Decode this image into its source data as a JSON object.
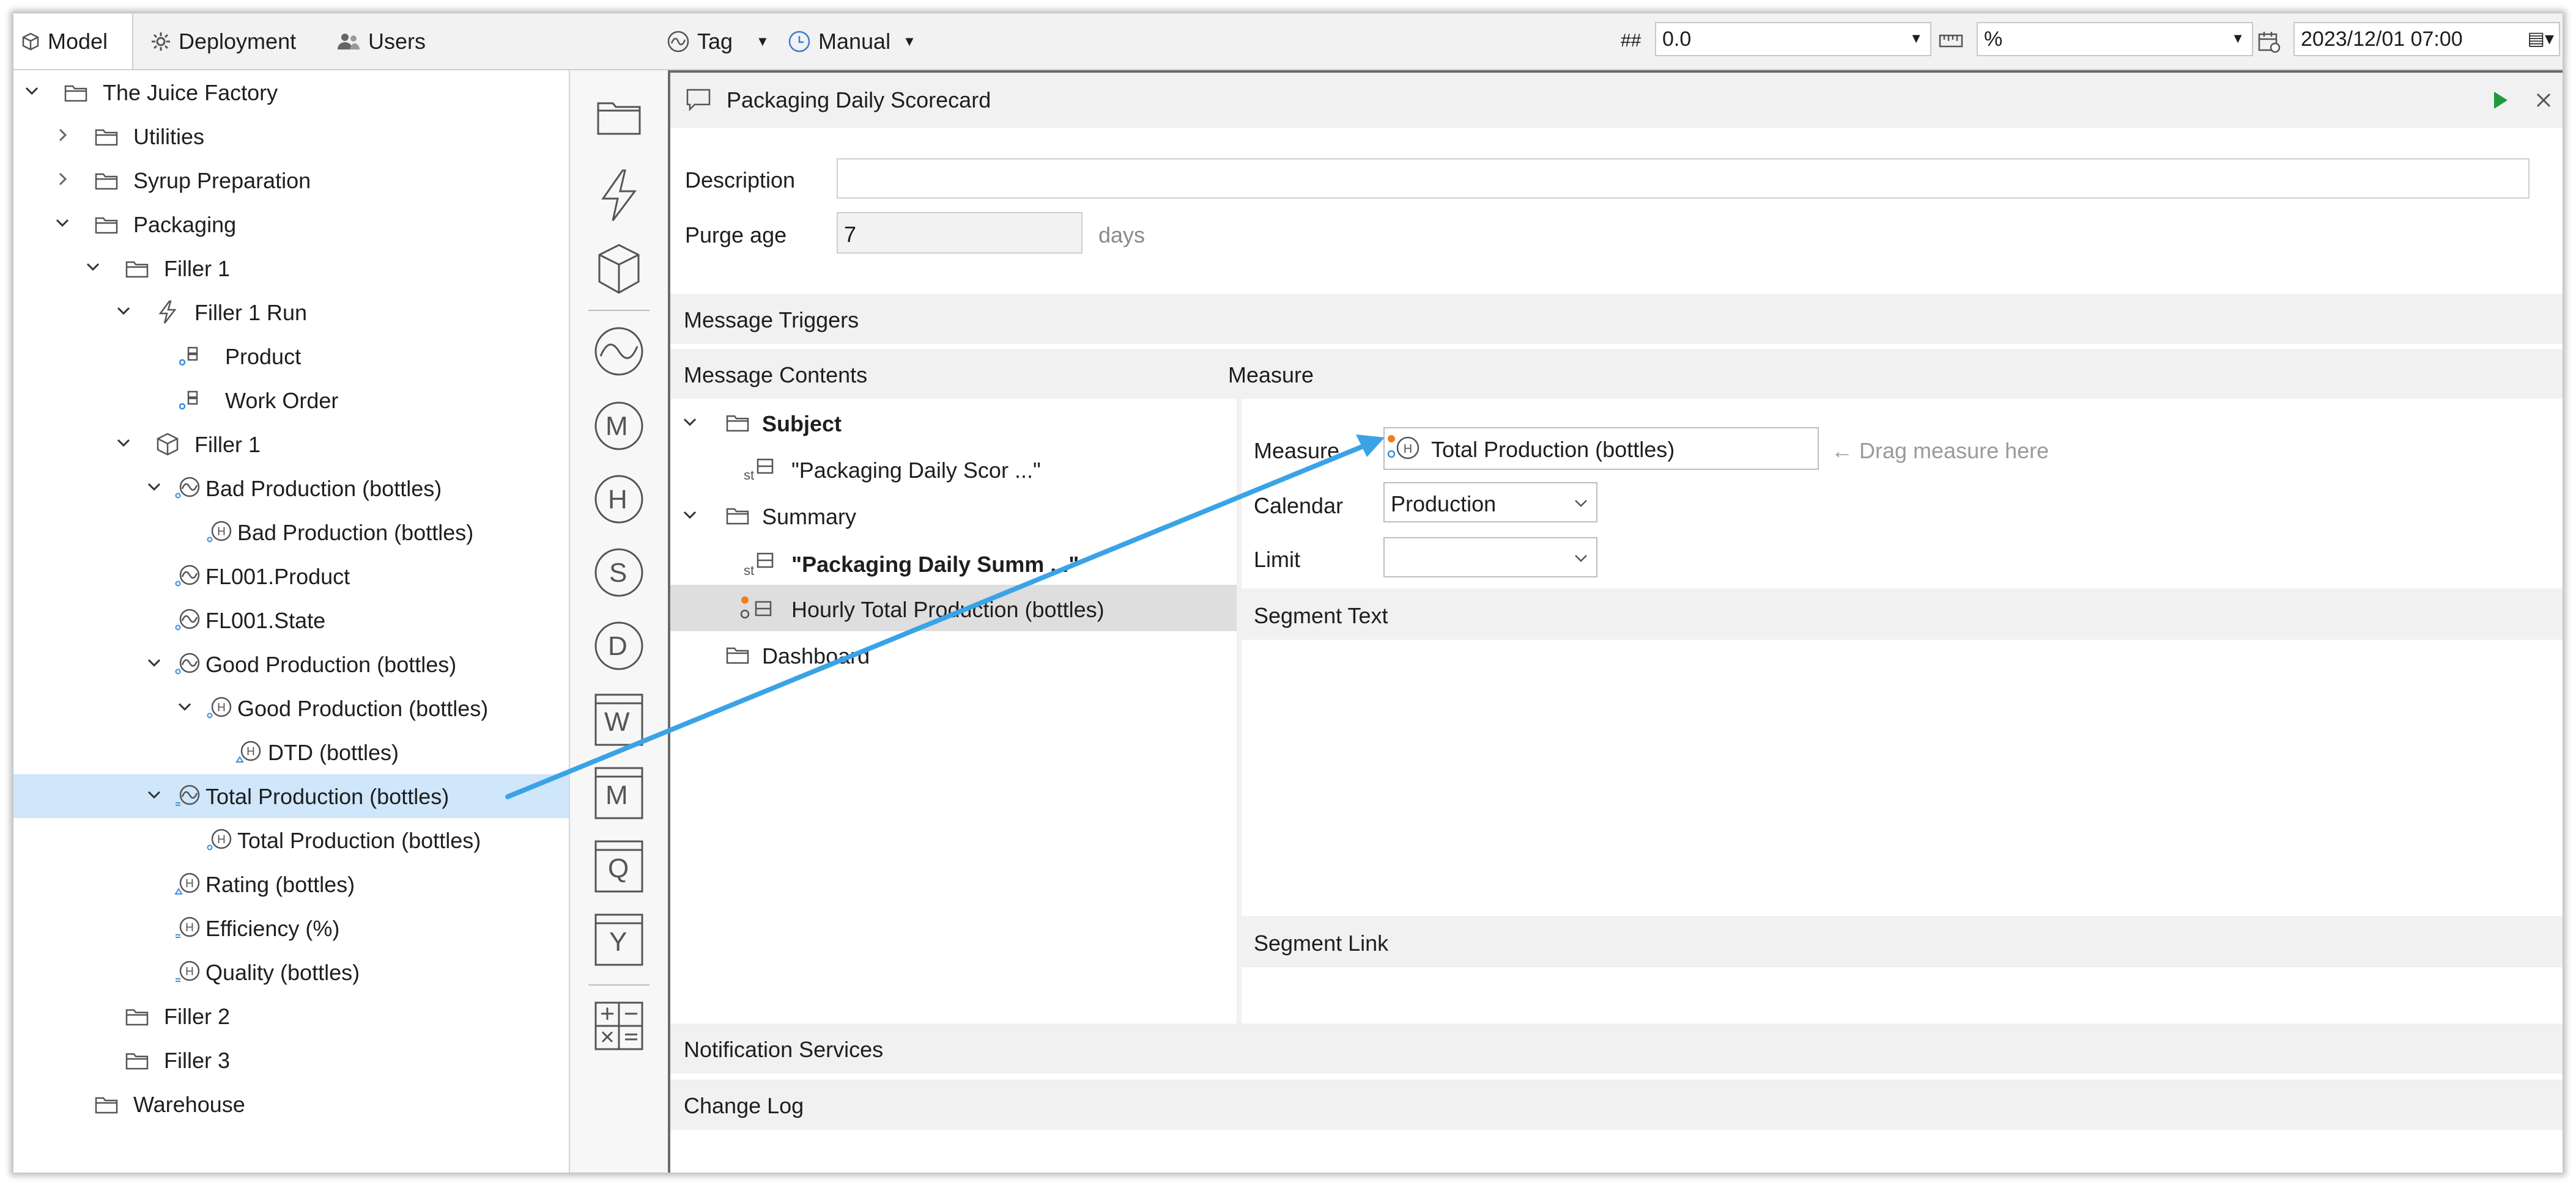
{
  "toolbar": {
    "tabs": [
      {
        "label": "Model",
        "icon": "cube-icon"
      },
      {
        "label": "Deployment",
        "icon": "gear-icon"
      },
      {
        "label": "Users",
        "icon": "users-icon"
      }
    ],
    "tag_label": "Tag",
    "mode_label": "Manual",
    "value_prefix": "##",
    "value": "0.0",
    "unit_value": "%",
    "datetime": "2023/12/01 07:00"
  },
  "tree": {
    "items": [
      {
        "label": "The Juice Factory",
        "icon": "folder-icon"
      },
      {
        "label": "Utilities",
        "icon": "folder-icon"
      },
      {
        "label": "Syrup Preparation",
        "icon": "folder-icon"
      },
      {
        "label": "Packaging",
        "icon": "folder-icon"
      },
      {
        "label": "Filler 1",
        "icon": "folder-icon"
      },
      {
        "label": "Filler 1 Run",
        "icon": "lightning-icon"
      },
      {
        "label": "Product",
        "icon": "attribute-icon"
      },
      {
        "label": "Work Order",
        "icon": "attribute-icon"
      },
      {
        "label": "Filler 1",
        "icon": "cube-icon"
      },
      {
        "label": "Bad Production (bottles)",
        "icon": "tag-icon"
      },
      {
        "label": "Bad Production (bottles)",
        "icon": "calculation-icon"
      },
      {
        "label": "FL001.Product",
        "icon": "tag-icon"
      },
      {
        "label": "FL001.State",
        "icon": "tag-icon"
      },
      {
        "label": "Good Production (bottles)",
        "icon": "tag-icon"
      },
      {
        "label": "Good Production (bottles)",
        "icon": "calculation-icon"
      },
      {
        "label": "DTD (bottles)",
        "icon": "calculation-icon"
      },
      {
        "label": "Total Production (bottles)",
        "icon": "tag-icon"
      },
      {
        "label": "Total Production (bottles)",
        "icon": "calculation-icon"
      },
      {
        "label": "Rating (bottles)",
        "icon": "calculation-icon"
      },
      {
        "label": "Efficiency (%)",
        "icon": "calculation-icon"
      },
      {
        "label": "Quality (bottles)",
        "icon": "calculation-icon"
      },
      {
        "label": "Filler 2",
        "icon": "folder-icon"
      },
      {
        "label": "Filler 3",
        "icon": "folder-icon"
      },
      {
        "label": "Warehouse",
        "icon": "folder-icon"
      }
    ]
  },
  "strip": {
    "icons": [
      "folder-icon",
      "lightning-icon",
      "cube-icon",
      "tag-icon",
      "minute-icon",
      "hour-icon",
      "shift-icon",
      "day-icon",
      "week-icon",
      "month-icon",
      "quarter-icon",
      "year-icon",
      "calculator-icon"
    ],
    "letters": [
      "M",
      "H",
      "S",
      "D",
      "W",
      "M",
      "Q",
      "Y"
    ]
  },
  "panel": {
    "title": "Packaging Daily Scorecard",
    "description_label": "Description",
    "description_value": "",
    "purge_label": "Purge age",
    "purge_value": "7",
    "purge_unit": "days",
    "section_triggers": "Message Triggers",
    "section_contents": "Message Contents",
    "section_measure": "Measure",
    "contents": {
      "subject": "Subject",
      "subject_text": "\"Packaging Daily Scor ...\"",
      "summary": "Summary",
      "summary_text": "\"Packaging Daily Summ ...\"",
      "measure_item": "Hourly Total Production (bottles)",
      "dashboard": "Dashboard",
      "st": "st"
    },
    "measure": {
      "measure_label": "Measure",
      "measure_value": "Total Production (bottles)",
      "drag_hint": "← Drag measure here",
      "calendar_label": "Calendar",
      "calendar_value": "Production",
      "limit_label": "Limit",
      "limit_value": ""
    },
    "section_segment_text": "Segment Text",
    "section_segment_link": "Segment Link",
    "section_notification": "Notification Services",
    "section_changelog": "Change Log"
  },
  "colors": {
    "arrow": "#3aa3e6",
    "selection": "#cfe6fb",
    "run_button": "#1f9a3a",
    "status_dot": "#f07e1e"
  }
}
